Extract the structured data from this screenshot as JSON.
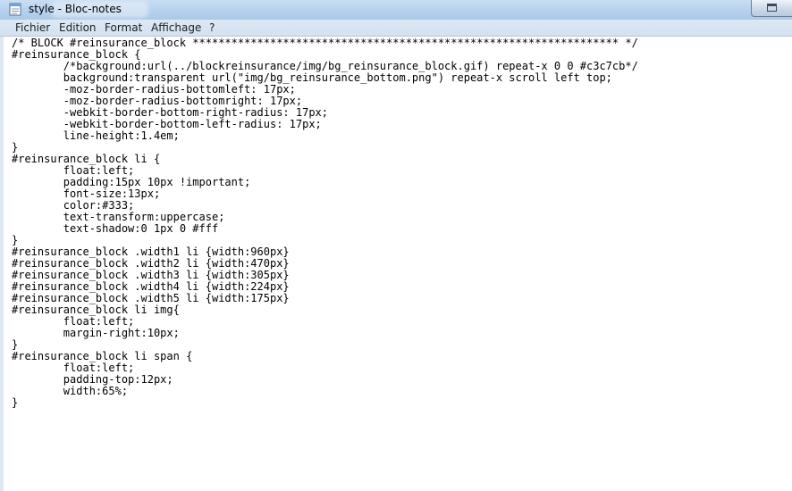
{
  "window": {
    "title": "style - Bloc-notes"
  },
  "menu": [
    {
      "label": "Fichier"
    },
    {
      "label": "Edition"
    },
    {
      "label": "Format"
    },
    {
      "label": "Affichage"
    },
    {
      "label": "?"
    }
  ],
  "editor": {
    "lines": [
      "/* BLOCK #reinsurance_block ****************************************************************** */",
      "#reinsurance_block {",
      "\t/*background:url(../blockreinsurance/img/bg_reinsurance_block.gif) repeat-x 0 0 #c3c7cb*/",
      "\tbackground:transparent url(\"img/bg_reinsurance_bottom.png\") repeat-x scroll left top;",
      "\t-moz-border-radius-bottomleft: 17px;",
      "\t-moz-border-radius-bottomright: 17px;",
      "\t-webkit-border-bottom-right-radius: 17px;",
      "\t-webkit-border-bottom-left-radius: 17px;",
      "\tline-height:1.4em;",
      "}",
      "#reinsurance_block li {",
      "\tfloat:left;",
      "\tpadding:15px 10px !important;",
      "\tfont-size:13px;",
      "\tcolor:#333;",
      "\ttext-transform:uppercase;",
      "\ttext-shadow:0 1px 0 #fff",
      "}",
      "#reinsurance_block .width1 li {width:960px}",
      "#reinsurance_block .width2 li {width:470px}",
      "#reinsurance_block .width3 li {width:305px}",
      "#reinsurance_block .width4 li {width:224px}",
      "#reinsurance_block .width5 li {width:175px}",
      "#reinsurance_block li img{",
      "\tfloat:left;",
      "\tmargin-right:10px;",
      "}",
      "#reinsurance_block li span {",
      "\tfloat:left;",
      "\tpadding-top:12px;",
      "\twidth:65%;",
      "}"
    ]
  },
  "icons": {
    "app": "notepad-icon",
    "maximize": "maximize-icon"
  }
}
